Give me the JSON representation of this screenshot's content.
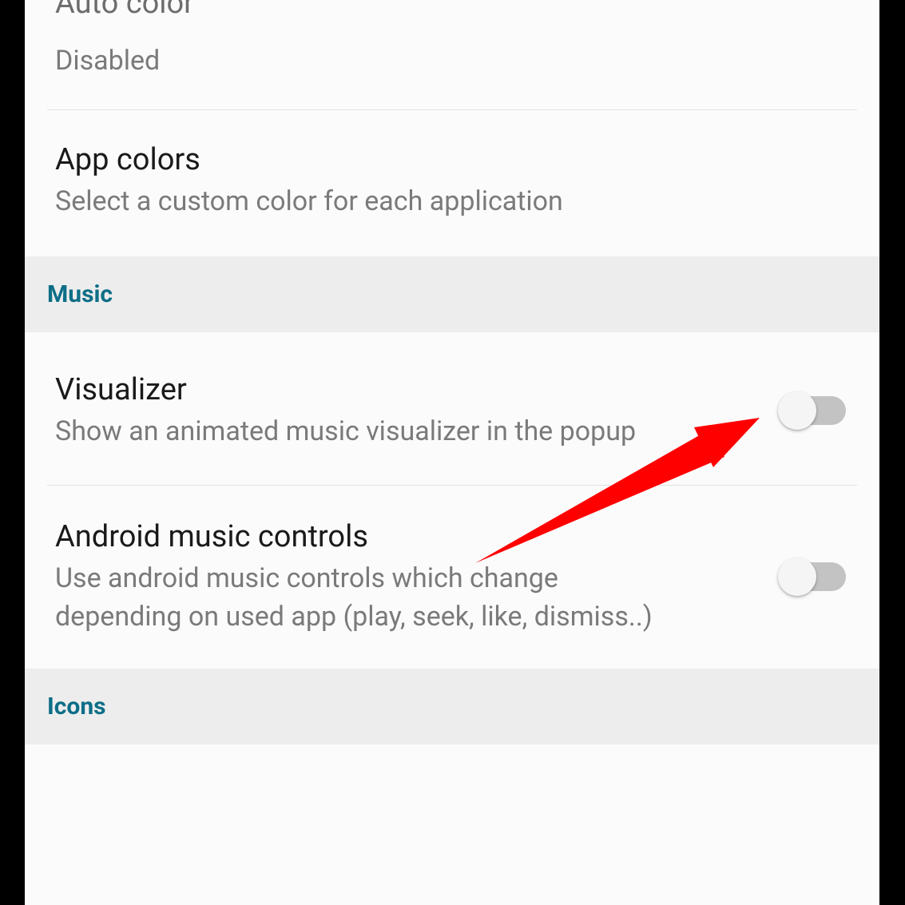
{
  "settings": {
    "auto_color": {
      "title": "Auto color",
      "status": "Disabled"
    },
    "app_colors": {
      "title": "App colors",
      "desc": "Select a custom color for each application"
    },
    "visualizer": {
      "title": "Visualizer",
      "desc": "Show an animated music visualizer in the popup",
      "enabled": false
    },
    "android_music_controls": {
      "title": "Android music controls",
      "desc": "Use android music controls which change depending on used app (play, seek, like, dismiss..)",
      "enabled": false
    }
  },
  "sections": {
    "music": "Music",
    "icons": "Icons"
  },
  "colors": {
    "section_header_text": "#0d6e87",
    "arrow_annotation": "#ff0000"
  }
}
